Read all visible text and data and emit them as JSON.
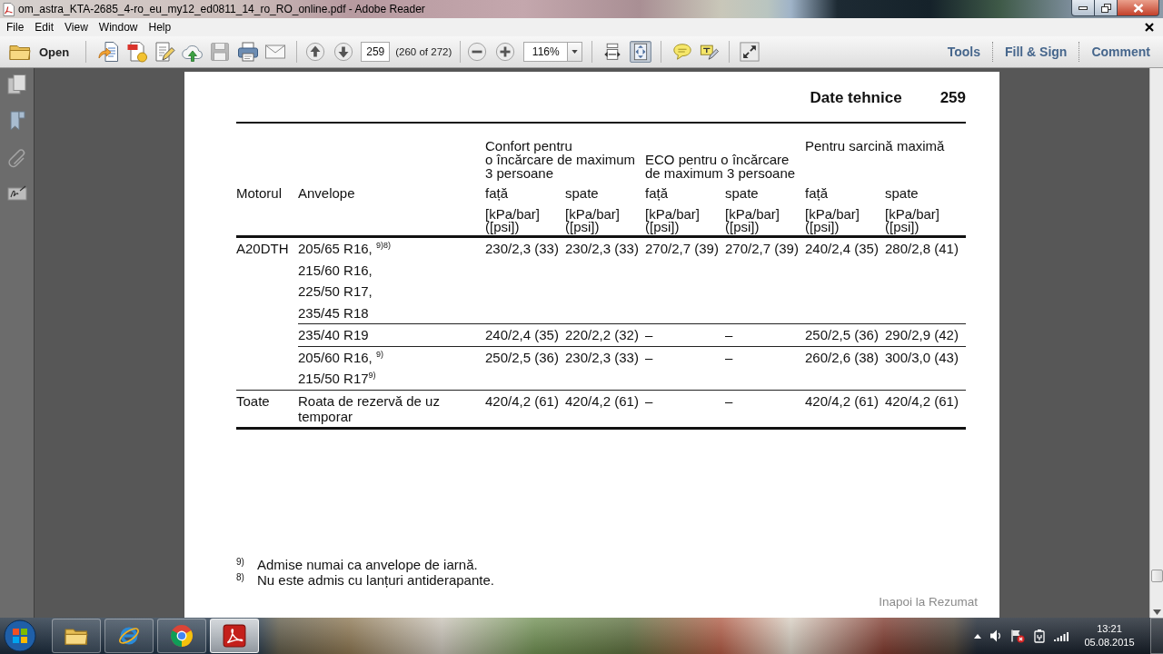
{
  "window": {
    "title": "om_astra_KTA-2685_4-ro_eu_my12_ed0811_14_ro_RO_online.pdf - Adobe Reader"
  },
  "menu": [
    "File",
    "Edit",
    "View",
    "Window",
    "Help"
  ],
  "toolbar": {
    "open": "Open",
    "file_tools": [
      {
        "kind": "create",
        "disabled": false
      },
      {
        "kind": "convert",
        "disabled": false
      },
      {
        "kind": "edit",
        "disabled": false
      },
      {
        "kind": "upload",
        "disabled": false
      },
      {
        "kind": "save",
        "disabled": true
      },
      {
        "kind": "print",
        "disabled": false
      },
      {
        "kind": "email",
        "disabled": false
      }
    ],
    "page_number": "259",
    "page_count": "(260 of 272)",
    "zoom": "116%",
    "view_tools": [
      {
        "kind": "fit-width",
        "selected": false
      },
      {
        "kind": "fit-page",
        "selected": true
      }
    ],
    "panes": [
      "Tools",
      "Fill & Sign",
      "Comment"
    ]
  },
  "page": {
    "title": "Date tehnice",
    "number": "259",
    "table": {
      "columns": [
        "Motorul",
        "Anvelope"
      ],
      "groups": [
        {
          "title": "Confort pentru\no încărcare de maximum\n3 persoane",
          "subcolumns": [
            {
              "label": "față",
              "unit": "[kPa/bar]\n([psi])"
            },
            {
              "label": "spate",
              "unit": "[kPa/bar]\n([psi])"
            }
          ]
        },
        {
          "title": "ECO pentru o încărcare\nde maximum 3 persoane",
          "subcolumns": [
            {
              "label": "față",
              "unit": "[kPa/bar]\n([psi])"
            },
            {
              "label": "spate",
              "unit": "[kPa/bar]\n([psi])"
            }
          ]
        },
        {
          "title": "Pentru sarcină maximă",
          "subcolumns": [
            {
              "label": "față",
              "unit": "[kPa/bar]\n([psi])"
            },
            {
              "label": "spate",
              "unit": "[kPa/bar]\n([psi])"
            }
          ]
        }
      ],
      "engines": [
        {
          "name": "A20DTH",
          "rows": [
            {
              "tyres": [
                "205/65 R16, $^{9)8)}$",
                "215/60 R16,",
                "225/50 R17,",
                "235/45 R18"
              ],
              "values": [
                "230/2,3 (33)",
                "230/2,3 (33)",
                "270/2,7 (39)",
                "270/2,7 (39)",
                "240/2,4 (35)",
                "280/2,8 (41)"
              ]
            },
            {
              "tyres": [
                "235/40 R19"
              ],
              "values": [
                "240/2,4 (35)",
                "220/2,2 (32)",
                "–",
                "–",
                "250/2,5 (36)",
                "290/2,9 (42)"
              ]
            },
            {
              "tyres": [
                "205/60 R16, $^{9)}$",
                "215/50 R17$^{9)}$"
              ],
              "values": [
                "250/2,5 (36)",
                "230/2,3 (33)",
                "–",
                "–",
                "260/2,6 (38)",
                "300/3,0 (43)"
              ]
            }
          ]
        },
        {
          "name": "Toate",
          "rows": [
            {
              "tyres": [
                "Roata de rezervă de uz\ntemporar"
              ],
              "values": [
                "420/4,2 (61)",
                "420/4,2 (61)",
                "–",
                "–",
                "420/4,2 (61)",
                "420/4,2 (61)"
              ]
            }
          ]
        }
      ]
    },
    "footnotes": [
      {
        "mark": "9)",
        "text": "Admise numai ca anvelope de iarnă."
      },
      {
        "mark": "8)",
        "text": "Nu este admis cu lanțuri antiderapante."
      }
    ],
    "link": "Inapoi la Rezumat"
  },
  "taskbar": {
    "apps": [
      {
        "kind": "folder",
        "selected": false
      },
      {
        "kind": "e-browser",
        "selected": false
      },
      {
        "kind": "ring-browser",
        "selected": false
      },
      {
        "kind": "pdf-reader",
        "selected": true
      }
    ],
    "time": "13:21",
    "date": "05.08.2015"
  }
}
